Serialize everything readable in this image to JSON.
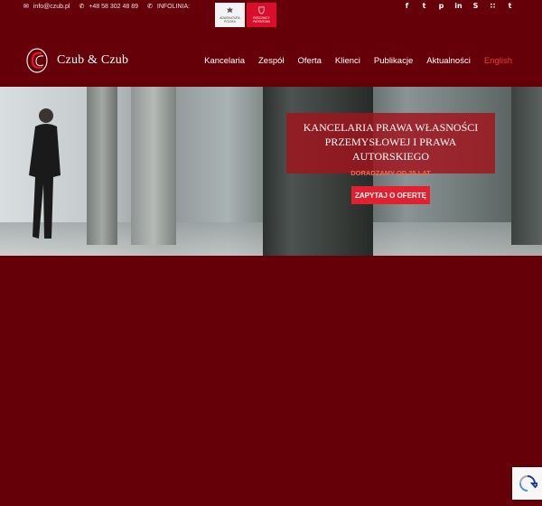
{
  "topbar": {
    "contact": {
      "email": "info@czub.pl",
      "phone": "+48 58 302 48 89",
      "infolinia": "INFOLINIA:"
    },
    "badges": {
      "adwokatura": "ADWOKATURA POLSKA",
      "rzecznicy": "RZECZNICY PATENTOWI"
    },
    "social": [
      {
        "name": "facebook-icon",
        "glyph": "f"
      },
      {
        "name": "twitter-icon",
        "glyph": "t"
      },
      {
        "name": "pinterest-icon",
        "glyph": "p"
      },
      {
        "name": "linkedin-icon",
        "glyph": "in"
      },
      {
        "name": "skype-icon",
        "glyph": "S"
      },
      {
        "name": "rss-icon",
        "glyph": "∷"
      },
      {
        "name": "tumblr-icon",
        "glyph": "t"
      }
    ]
  },
  "header": {
    "logo_text": "Czub & Czub",
    "nav": [
      "Kancelaria",
      "Zespół",
      "Oferta",
      "Klienci",
      "Publikacje",
      "Aktualności",
      "English"
    ],
    "active_nav": "English"
  },
  "hero": {
    "title_line1": "KANCELARIA PRAWA WŁASNOŚCI",
    "title_line2": "PRZEMYSŁOWEJ I PRAWA AUTORSKIEGO",
    "subtitle": "DORADZAMY OD 25 LAT",
    "cta": "ZAPYTAJ O OFERTĘ"
  },
  "colors": {
    "background": "#650009",
    "accent": "#e2202f",
    "nav_active": "#e3413f",
    "hero_box": "#a0141e"
  }
}
